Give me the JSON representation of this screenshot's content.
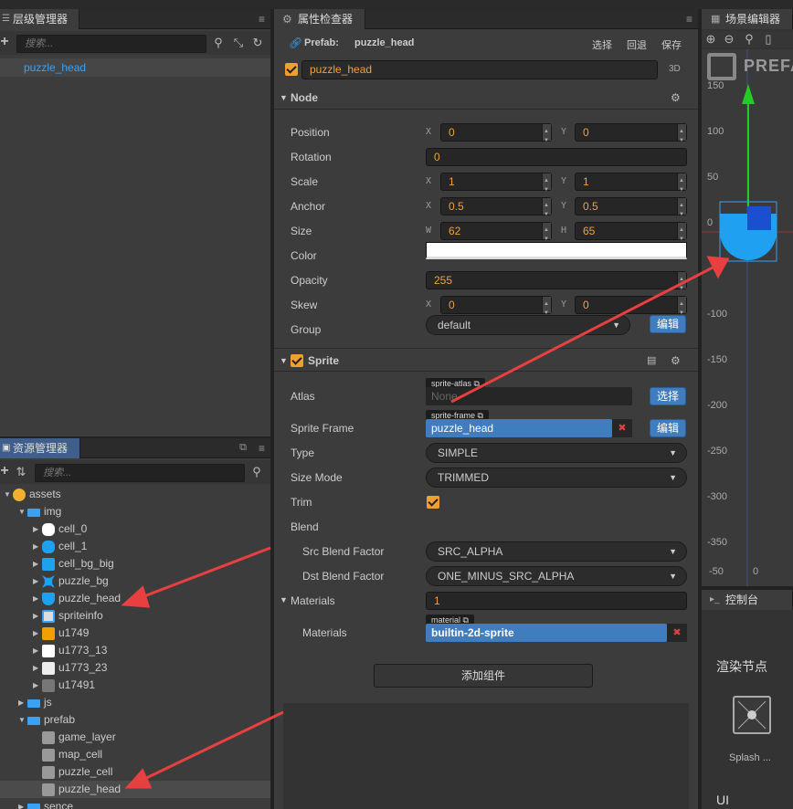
{
  "hierarchy": {
    "title": "层级管理器",
    "search_placeholder": "搜索...",
    "selected_node": "puzzle_head"
  },
  "assets": {
    "title": "资源管理器",
    "search_placeholder": "搜索...",
    "tree": [
      {
        "label": "assets",
        "kind": "root"
      },
      {
        "label": "img",
        "kind": "folder"
      },
      {
        "label": "cell_0",
        "kind": "white-hex"
      },
      {
        "label": "cell_1",
        "kind": "blue-hex"
      },
      {
        "label": "cell_bg_big",
        "kind": "blue-square"
      },
      {
        "label": "puzzle_bg",
        "kind": "blue-cross"
      },
      {
        "label": "puzzle_head",
        "kind": "blue-head"
      },
      {
        "label": "spriteinfo",
        "kind": "spriteinfo"
      },
      {
        "label": "u1749",
        "kind": "orange"
      },
      {
        "label": "u1773_13",
        "kind": "white"
      },
      {
        "label": "u1773_23",
        "kind": "white2"
      },
      {
        "label": "u17491",
        "kind": "gray"
      },
      {
        "label": "js",
        "kind": "folder"
      },
      {
        "label": "prefab",
        "kind": "folder"
      },
      {
        "label": "game_layer",
        "kind": "prefab"
      },
      {
        "label": "map_cell",
        "kind": "prefab"
      },
      {
        "label": "puzzle_cell",
        "kind": "prefab"
      },
      {
        "label": "puzzle_head",
        "kind": "prefab"
      },
      {
        "label": "sence",
        "kind": "folder"
      }
    ]
  },
  "inspector": {
    "title": "属性检查器",
    "prefab_label": "Prefab:",
    "prefab_name": "puzzle_head",
    "actions": [
      "选择",
      "回退",
      "保存"
    ],
    "node_name": "puzzle_head",
    "mode_3d": "3D",
    "node_section": "Node",
    "position": {
      "label": "Position",
      "x_axis": "X",
      "x": "0",
      "y_axis": "Y",
      "y": "0"
    },
    "rotation": {
      "label": "Rotation",
      "value": "0"
    },
    "scale": {
      "label": "Scale",
      "x_axis": "X",
      "x": "1",
      "y_axis": "Y",
      "y": "1"
    },
    "anchor": {
      "label": "Anchor",
      "x_axis": "X",
      "x": "0.5",
      "y_axis": "Y",
      "y": "0.5"
    },
    "size": {
      "label": "Size",
      "w_axis": "W",
      "w": "62",
      "h_axis": "H",
      "h": "65"
    },
    "color": {
      "label": "Color",
      "swatch": "#ffffff"
    },
    "opacity": {
      "label": "Opacity",
      "value": "255"
    },
    "skew": {
      "label": "Skew",
      "x_axis": "X",
      "x": "0",
      "y_axis": "Y",
      "y": "0"
    },
    "group": {
      "label": "Group",
      "value": "default",
      "edit": "编辑"
    },
    "sprite_section": "Sprite",
    "atlas": {
      "label": "Atlas",
      "tag": "sprite-atlas",
      "value": "None",
      "button": "选择"
    },
    "sprite_frame": {
      "label": "Sprite Frame",
      "tag": "sprite-frame",
      "value": "puzzle_head",
      "button": "编辑"
    },
    "type": {
      "label": "Type",
      "value": "SIMPLE"
    },
    "size_mode": {
      "label": "Size Mode",
      "value": "TRIMMED"
    },
    "trim": {
      "label": "Trim"
    },
    "blend": {
      "label": "Blend"
    },
    "src_blend": {
      "label": "Src Blend Factor",
      "value": "SRC_ALPHA"
    },
    "dst_blend": {
      "label": "Dst Blend Factor",
      "value": "ONE_MINUS_SRC_ALPHA"
    },
    "materials_count": {
      "label": "Materials",
      "value": "1"
    },
    "materials": {
      "label": "Materials",
      "tag": "material",
      "value": "builtin-2d-sprite"
    },
    "add_component": "添加组件"
  },
  "scene": {
    "title": "场景编辑器",
    "watermark": "PREFAB",
    "ruler_y": [
      "150",
      "100",
      "50",
      "0",
      "-100",
      "-150",
      "-200",
      "-250",
      "-300",
      "-350",
      "-50"
    ],
    "ruler_x0": "0"
  },
  "console": {
    "title": "控制台",
    "render_node": "渲染节点",
    "splash": "Splash ...",
    "ui": "UI"
  }
}
